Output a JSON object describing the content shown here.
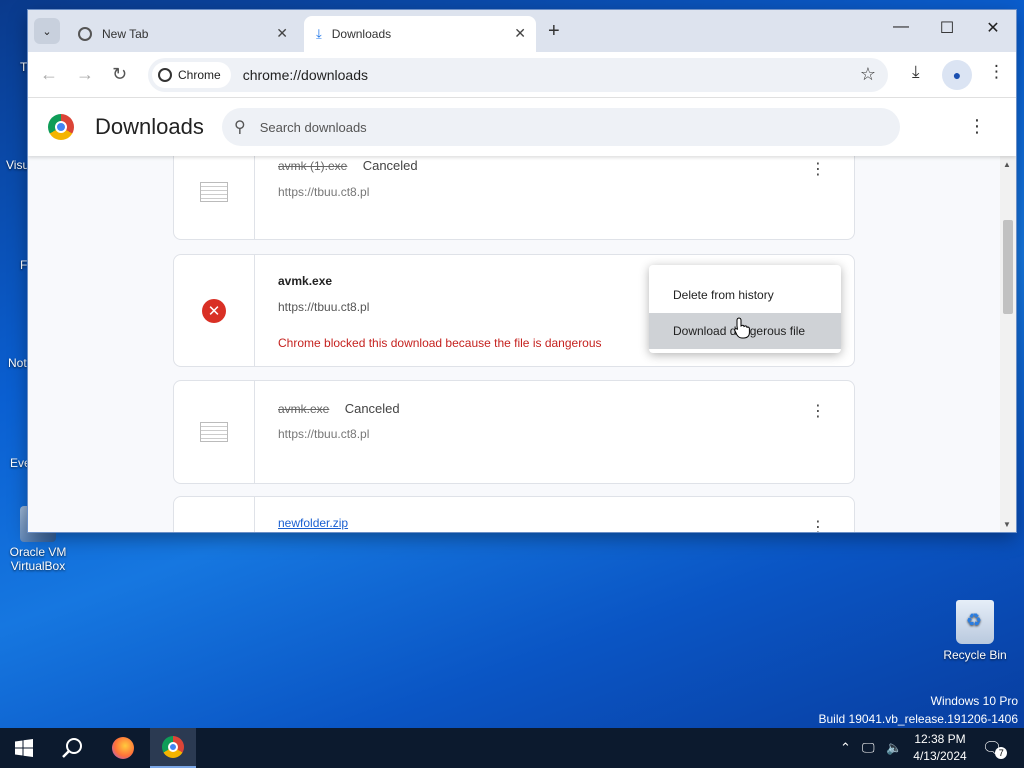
{
  "browser": {
    "tabs": [
      {
        "title": "New Tab",
        "close": "✕"
      },
      {
        "title": "Downloads",
        "close": "✕"
      }
    ],
    "new_tab_symbol": "+",
    "window_controls": {
      "minimize": "—",
      "maximize": "☐",
      "close": "✕"
    },
    "chip_label": "Chrome",
    "url": "chrome://downloads"
  },
  "downloads_page": {
    "title": "Downloads",
    "search_placeholder": "Search downloads",
    "items": [
      {
        "filename": "avmk (1).exe",
        "status": "Canceled",
        "url": "https://tbuu.ct8.pl",
        "state": "canceled"
      },
      {
        "filename": "avmk.exe",
        "url": "https://tbuu.ct8.pl",
        "warning": "Chrome blocked this download because the file is dangerous",
        "state": "blocked"
      },
      {
        "filename": "avmk.exe",
        "status": "Canceled",
        "url": "https://tbuu.ct8.pl",
        "state": "canceled"
      },
      {
        "filename": "newfolder.zip",
        "state": "complete"
      }
    ]
  },
  "context_menu": {
    "items": [
      {
        "label": "Delete from history"
      },
      {
        "label": "Download dangerous file",
        "hovered": true
      }
    ]
  },
  "desktop": {
    "icons": [
      {
        "label": "Oracle VM VirtualBox"
      },
      {
        "label": "Recycle Bin"
      }
    ],
    "partial_labels": [
      "T",
      "Visu",
      "F",
      "Not",
      "Eve"
    ]
  },
  "watermark": {
    "line1": "Windows 10 Pro",
    "line2": "Build 19041.vb_release.191206-1406"
  },
  "taskbar": {
    "time": "12:38 PM",
    "date": "4/13/2024",
    "notification_count": "7"
  },
  "colors": {
    "accent": "#1a73e8",
    "danger": "#d93025",
    "link": "#1a5fd1"
  }
}
